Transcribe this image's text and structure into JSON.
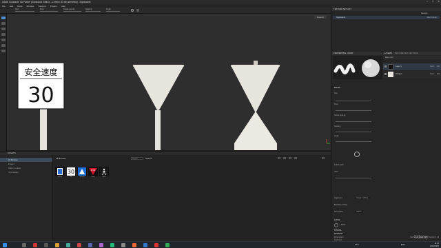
{
  "window": {
    "title": "Adobe Substance 3D Painter (Substance Edition) - Commo 2D day streaming - Signboards",
    "controls": [
      "–",
      "□",
      "✕"
    ]
  },
  "menu": [
    "File",
    "Edit",
    "Mode",
    "Window",
    "Viewport",
    "Plugins",
    "Help"
  ],
  "toolbar": {
    "items": [
      "Size",
      "Flow",
      "Stroke opacity",
      "Spacing",
      "Angle"
    ]
  },
  "viewport": {
    "mode_label": "Material",
    "sign_text_top": "安全速度",
    "sign_text_num": "30",
    "colors": {
      "bg": "#2e2e2e",
      "sign_face": "#ffffff",
      "sign_border": "#1a1a1a",
      "pole": "#e6e3df",
      "triangle": "#e8e4de"
    }
  },
  "assets": {
    "header": "ASSETS",
    "nav": [
      "All libraries",
      "Project",
      "Shelf - content",
      "Your assets"
    ],
    "selected_nav": "All libraries",
    "toolbar_label": "All libraries",
    "search_placeholder": "Search",
    "search_label": "Search",
    "thumbs": [
      {
        "label": "Speed",
        "color": "#2b6fd6"
      },
      {
        "label": "30",
        "color": "#ffffff"
      },
      {
        "label": "School",
        "color": "#1f6fd6"
      },
      {
        "label": "Stop",
        "color": "#d0172a"
      },
      {
        "label": "Walk",
        "color": "#1a1a1a"
      }
    ]
  },
  "texture_set_list": {
    "header": "TEXTURE SET LIST",
    "settings": "Settings",
    "item": "Signboards",
    "shader": "Main shader"
  },
  "properties": {
    "header": "PROPERTIES - PAINT",
    "section_brush": "BRUSH",
    "rows": [
      "Size",
      "Flow",
      "Stroke opacity",
      "Spacing",
      "Angle",
      "Follow path",
      "Jitter",
      "Alignment",
      "Backface culling",
      "Size space"
    ],
    "alignment_value": "Tangent | Wrap",
    "size_space_value": "Object",
    "section_alpha": "ALPHA",
    "alpha_value": "Basic",
    "section_stencil": "STENCIL",
    "section_material": "MATERIAL",
    "section_params": "Parameters",
    "hardness_label": "Hardness"
  },
  "layers": {
    "tab_layers": "LAYERS",
    "tab_tex_settings": "TEXTURE SET SETTINGS",
    "blend_label": "Base color",
    "rows": [
      {
        "name": "Layer 1",
        "mode": "Norm",
        "value": "100"
      },
      {
        "name": "Fill layer",
        "mode": "Norm",
        "value": "100"
      }
    ]
  },
  "status": {
    "text": "Cache disk usage: 68% | Version: 9.1.2"
  },
  "taskbar": {
    "time": "11:24",
    "date": "2024/04/05",
    "temp": "18°C",
    "lang": "ENG"
  },
  "watermark": "Udemy"
}
